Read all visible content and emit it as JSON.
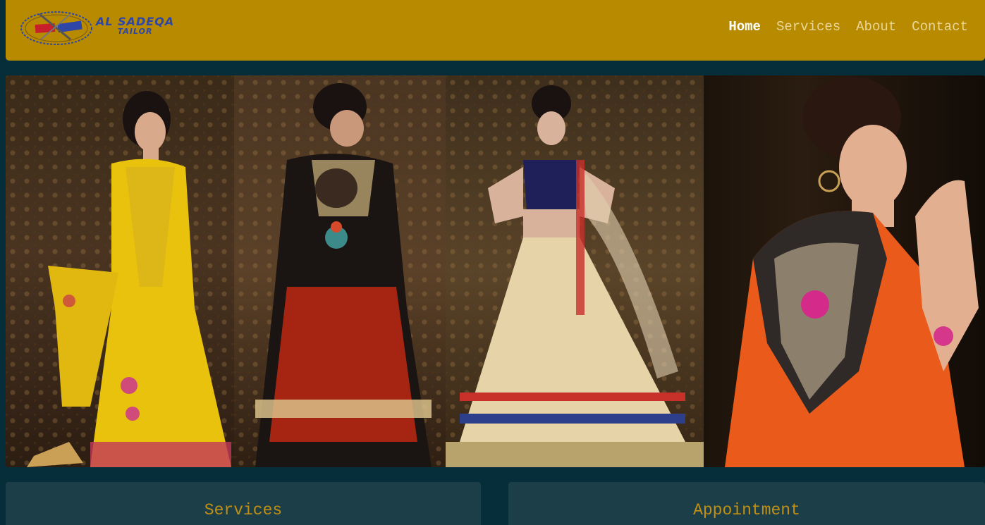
{
  "brand": {
    "line1": "AL SADEQA",
    "line2": "TAILOR",
    "logo_colors": {
      "red": "#c8202a",
      "blue": "#2d46a8"
    }
  },
  "nav": {
    "items": [
      {
        "label": "Home",
        "active": true
      },
      {
        "label": "Services",
        "active": false
      },
      {
        "label": "About",
        "active": false
      },
      {
        "label": "Contact",
        "active": false
      }
    ]
  },
  "hero": {
    "panels": [
      {
        "name": "model-yellow-outfit",
        "dress_color": "#e8c20c"
      },
      {
        "name": "model-black-red-outfit",
        "dress_color": "#a52412"
      },
      {
        "name": "model-cream-lehenga",
        "dress_color": "#e6d3a8"
      },
      {
        "name": "model-orange-outfit",
        "dress_color": "#ea5a1a"
      }
    ]
  },
  "sections": {
    "services_title": "Services",
    "appointment_title": "Appointment"
  },
  "colors": {
    "navbar": "#b88a00",
    "background": "#062d3a",
    "card": "#1b3e48",
    "heading": "#c28f13"
  }
}
